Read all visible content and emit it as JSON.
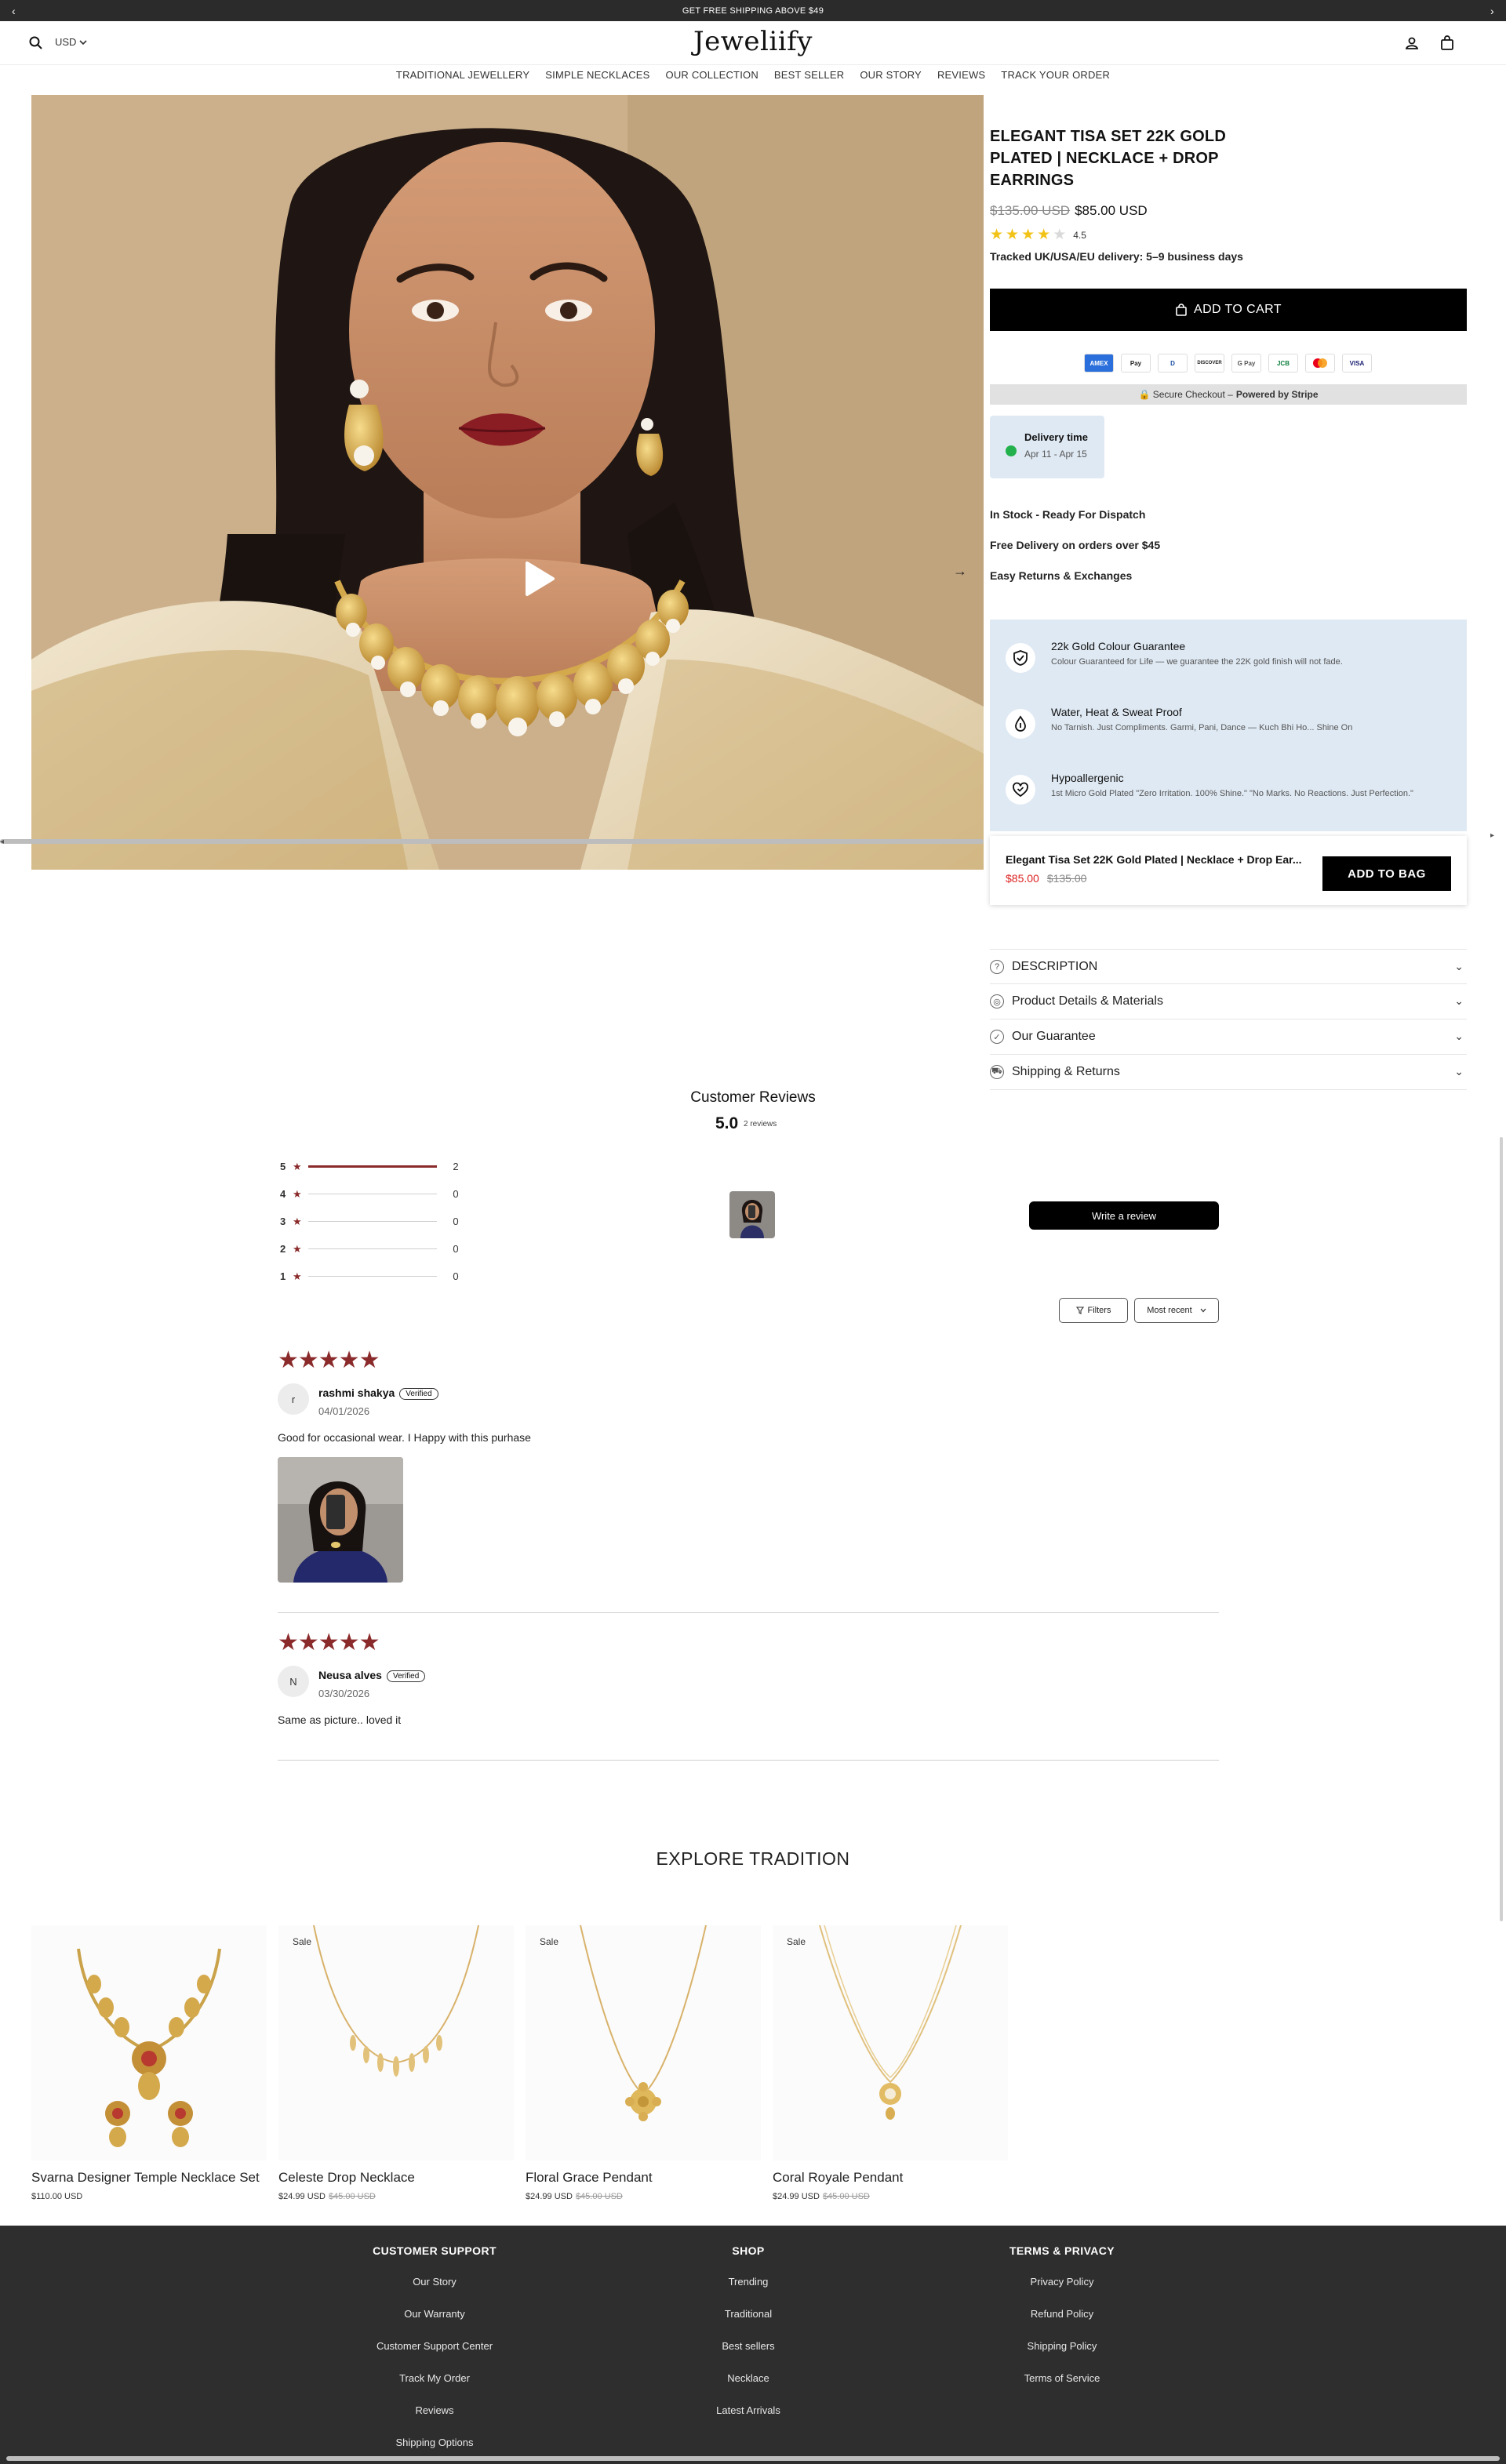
{
  "announcement": {
    "text": "GET FREE SHIPPING ABOVE $49",
    "prev": "‹",
    "next": "›"
  },
  "header": {
    "logo": "Jeweliify",
    "currency": "USD"
  },
  "nav": [
    "TRADITIONAL JEWELLERY",
    "SIMPLE NECKLACES",
    "OUR COLLECTION",
    "BEST SELLER",
    "OUR STORY",
    "REVIEWS",
    "TRACK YOUR ORDER"
  ],
  "gallery": {
    "slide_count": 7,
    "active_slide": 1
  },
  "product": {
    "title": "ELEGANT TISA SET 22K GOLD PLATED | NECKLACE + DROP EARRINGS",
    "price_old": "$135.00 USD",
    "price_new": "$85.00 USD",
    "rating": "4.5",
    "rating_value": 4.5,
    "delivery_note": "Tracked UK/USA/EU delivery: 5–9 business days",
    "add_to_cart": "ADD TO CART",
    "payment_methods": [
      "AMEX",
      "Pay",
      "D",
      "DISCOVER",
      "G Pay",
      "JCB",
      "MC",
      "VISA"
    ],
    "secure_prefix": "🔒 Secure Checkout –",
    "secure_strong": "Powered by Stripe",
    "delivery_time_label": "Delivery time",
    "delivery_time_range": "Apr 11 - Apr 15",
    "features": [
      "In Stock - Ready For Dispatch",
      "Free Delivery on orders over $45",
      "Easy Returns & Exchanges"
    ],
    "guarantees": [
      {
        "title": "22k Gold Colour Guarantee",
        "text": "Colour Guaranteed for Life — we guarantee the 22K gold finish will not fade.",
        "icon": "shield-check-icon"
      },
      {
        "title": "Water, Heat & Sweat Proof",
        "text": "No Tarnish. Just Compliments. Garmi, Pani, Dance — Kuch Bhi Ho... Shine On",
        "icon": "water-drop-icon"
      },
      {
        "title": "Hypoallergenic",
        "text": "1st Micro Gold Plated \"Zero Irritation. 100% Shine.\" \"No Marks. No Reactions. Just Perfection.\"",
        "icon": "heart-check-icon"
      }
    ],
    "sticky": {
      "name": "Elegant Tisa Set 22K Gold Plated | Necklace + Drop Ear...",
      "price_new": "$85.00",
      "price_old": "$135.00",
      "button": "ADD TO BAG"
    },
    "accordion": [
      {
        "label": "DESCRIPTION",
        "icon": "?"
      },
      {
        "label": "Product Details & Materials",
        "icon": "◎"
      },
      {
        "label": "Our Guarantee",
        "icon": "✓"
      },
      {
        "label": "Shipping & Returns",
        "icon": "⛟"
      }
    ]
  },
  "reviews": {
    "title": "Customer Reviews",
    "average": "5.0",
    "count": "2 reviews",
    "breakdown": [
      {
        "stars": "5",
        "count": "2",
        "fraction": 1.0
      },
      {
        "stars": "4",
        "count": "0",
        "fraction": 0
      },
      {
        "stars": "3",
        "count": "0",
        "fraction": 0
      },
      {
        "stars": "2",
        "count": "0",
        "fraction": 0
      },
      {
        "stars": "1",
        "count": "0",
        "fraction": 0
      }
    ],
    "write_review": "Write a review",
    "filters": "Filters",
    "sort": "Most recent",
    "items": [
      {
        "stars": "★★★★★",
        "initial": "r",
        "name": "rashmi shakya",
        "badge": "Verified",
        "date": "04/01/2026",
        "text": "Good for occasional wear. I Happy with this purhase"
      },
      {
        "stars": "★★★★★",
        "initial": "N",
        "name": "Neusa alves",
        "badge": "Verified",
        "date": "03/30/2026",
        "text": "Same as picture.. loved it"
      }
    ]
  },
  "explore": {
    "title": "EXPLORE TRADITION",
    "products": [
      {
        "name": "Svarna Designer Temple Necklace Set",
        "price": "$110.00 USD",
        "old_price": "",
        "sale": ""
      },
      {
        "name": "Celeste Drop Necklace",
        "price": "$24.99 USD",
        "old_price": "$45.00 USD",
        "sale": "Sale"
      },
      {
        "name": "Floral Grace Pendant",
        "price": "$24.99 USD",
        "old_price": "$45.00 USD",
        "sale": "Sale"
      },
      {
        "name": "Coral Royale Pendant",
        "price": "$24.99 USD",
        "old_price": "$45.00 USD",
        "sale": "Sale"
      }
    ]
  },
  "footer": {
    "support": {
      "title": "CUSTOMER SUPPORT",
      "links": [
        "Our Story",
        "Our Warranty",
        "Customer Support Center",
        "Track My Order",
        "Reviews",
        "Shipping Options"
      ]
    },
    "shop": {
      "title": "SHOP",
      "links": [
        "Trending",
        "Traditional",
        "Best sellers",
        "Necklace",
        "Latest Arrivals"
      ]
    },
    "terms": {
      "title": "TERMS & PRIVACY",
      "links": [
        "Privacy Policy",
        "Refund Policy",
        "Shipping Policy",
        "Terms of Service"
      ]
    }
  },
  "colors": {
    "accent_star": "#8a2a2a",
    "rating_star": "#f2c316",
    "cta": "#000000",
    "info_bg": "#dfe9f3",
    "footer_bg": "#2e2e2e",
    "sale_price": "#dd2222"
  }
}
